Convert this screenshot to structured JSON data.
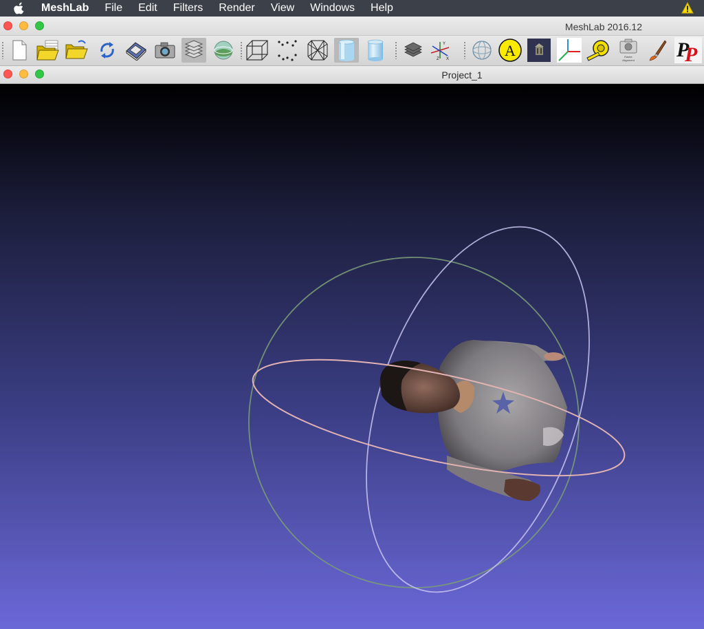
{
  "menubar": {
    "app_name": "MeshLab",
    "items": [
      "File",
      "Edit",
      "Filters",
      "Render",
      "View",
      "Windows",
      "Help"
    ]
  },
  "window": {
    "title": "MeshLab 2016.12"
  },
  "toolbar": {
    "buttons": [
      {
        "name": "new-project-button",
        "icon": "new-document-icon"
      },
      {
        "name": "open-project-button",
        "icon": "open-project-folder-icon"
      },
      {
        "name": "import-mesh-button",
        "icon": "open-folder-icon"
      },
      {
        "name": "reload-button",
        "icon": "reload-icon"
      },
      {
        "name": "export-mesh-button",
        "icon": "save-disk-icon"
      },
      {
        "name": "snapshot-button",
        "icon": "camera-icon"
      },
      {
        "name": "layers-button",
        "icon": "layers-icon",
        "active": true
      },
      {
        "name": "raster-button",
        "icon": "raster-globe-icon"
      },
      {
        "name": "bbox-button",
        "icon": "bounding-box-icon"
      },
      {
        "name": "points-button",
        "icon": "points-icon"
      },
      {
        "name": "wireframe-button",
        "icon": "wireframe-icon"
      },
      {
        "name": "flat-shading-button",
        "icon": "flat-cylinder-icon",
        "active": true
      },
      {
        "name": "smooth-shading-button",
        "icon": "smooth-cylinder-icon"
      },
      {
        "name": "lighting-button",
        "icon": "mesh-lighting-icon"
      },
      {
        "name": "show-axis-button",
        "icon": "axis-icon"
      },
      {
        "name": "trackball-button",
        "icon": "trackball-icon"
      },
      {
        "name": "annotation-button",
        "icon": "annotation-a-icon"
      },
      {
        "name": "texture-button",
        "icon": "texture-icon"
      },
      {
        "name": "align-axis-button",
        "icon": "align-axis-icon"
      },
      {
        "name": "measure-tool-button",
        "icon": "tape-measure-icon"
      },
      {
        "name": "raster-alignment-button",
        "icon": "raster-alignment-icon",
        "label": "Raster Alignment"
      },
      {
        "name": "paint-button",
        "icon": "paint-brush-icon"
      },
      {
        "name": "point-picker-button",
        "icon": "point-picker-pp-icon"
      }
    ]
  },
  "subwindow": {
    "title": "Project_1"
  },
  "colors": {
    "menubar_bg": "#3b4049",
    "viewport_top": "#000000",
    "viewport_bottom": "#6b68d8",
    "trackball_green": "#7a9a78",
    "trackball_blue": "#c8c4f0",
    "trackball_red": "#e2b3b3"
  }
}
